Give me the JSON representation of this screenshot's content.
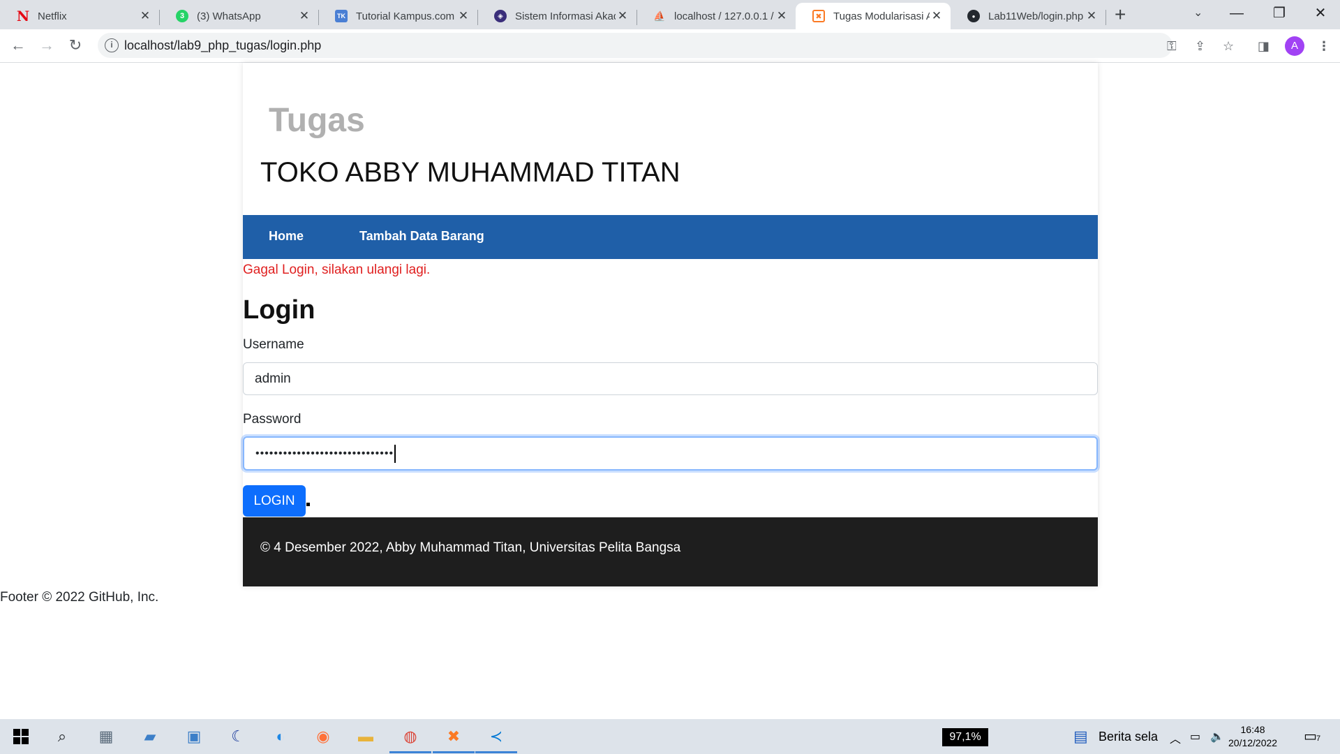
{
  "browser": {
    "tabs": [
      {
        "title": "Netflix",
        "icon": "netflix-icon",
        "color": "#e50914",
        "glyph": "N",
        "active": false
      },
      {
        "title": "(3) WhatsApp",
        "icon": "whatsapp-icon",
        "color": "#25d366",
        "glyph": "3",
        "active": false
      },
      {
        "title": "Tutorial Kampus.com",
        "icon": "tutorial-kampus-icon",
        "color": "#4a7fd4",
        "glyph": "TK",
        "active": false
      },
      {
        "title": "Sistem Informasi Akad",
        "icon": "university-logo-icon",
        "color": "#3a2e7a",
        "glyph": "◈",
        "active": false
      },
      {
        "title": "localhost / 127.0.0.1 /",
        "icon": "phpmyadmin-icon",
        "color": "#e7a33e",
        "glyph": "⛵",
        "active": false
      },
      {
        "title": "Tugas Modularisasi A",
        "icon": "xampp-icon",
        "color": "#fb7a24",
        "glyph": "✖",
        "active": true
      },
      {
        "title": "Lab11Web/login.php",
        "icon": "github-icon",
        "color": "#24292f",
        "glyph": "●",
        "active": false
      }
    ],
    "new_tab_glyph": "+",
    "url": "localhost/lab9_php_tugas/login.php",
    "profile_initial": "A",
    "window_controls": {
      "minimize": "—",
      "maximize": "❐",
      "close": "✕"
    }
  },
  "page": {
    "site_logo": "Tugas",
    "site_title": "TOKO ABBY MUHAMMAD TITAN",
    "nav": [
      {
        "label": "Home"
      },
      {
        "label": "Tambah Data Barang"
      }
    ],
    "error": "Gagal Login, silakan ulangi lagi.",
    "login_title": "Login",
    "username_label": "Username",
    "username_value": "admin",
    "password_label": "Password",
    "password_masked": "••••••••••••••••••••••••••••••",
    "login_button": "LOGIN",
    "footer_text": "© 4 Desember 2022, Abby Muhammad Titan, Universitas Pelita Bangsa",
    "outer_footer": "Footer © 2022 GitHub, Inc."
  },
  "taskbar": {
    "zoom": "97,1%",
    "news": "Berita sela",
    "time": "16:48",
    "date": "20/12/2022",
    "notification_count": "7"
  },
  "colors": {
    "nav_bar": "#1f5fa8",
    "login_button": "#0d6efd",
    "error_text": "#e02020",
    "footer_bg": "#1e1e1e"
  }
}
